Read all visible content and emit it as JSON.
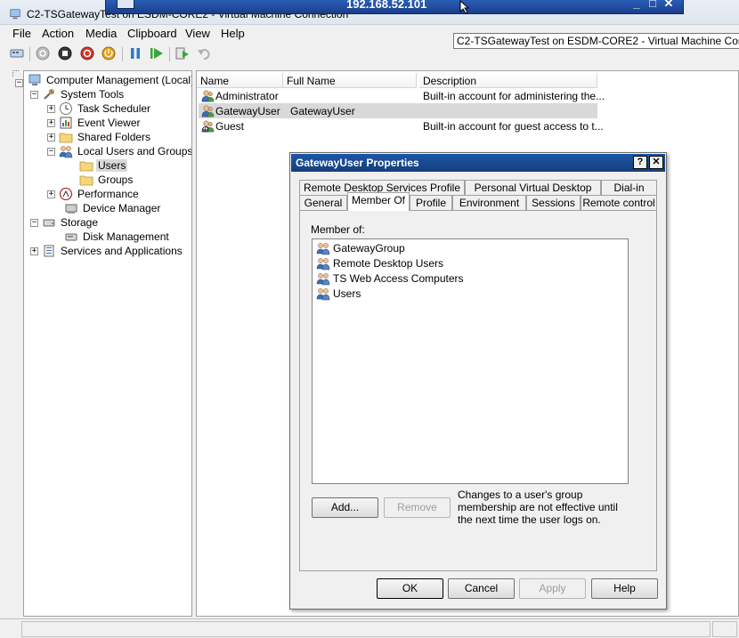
{
  "window": {
    "title": "C2-TSGatewayTest on ESDM-CORE2 - Virtual Machine Connection",
    "remote_address": "192.168.52.101",
    "remote_controls": [
      "_",
      "□",
      "✕"
    ]
  },
  "tooltip": "C2-TSGatewayTest on ESDM-CORE2 - Virtual Machine Conn",
  "menu": [
    "File",
    "Action",
    "Media",
    "Clipboard",
    "View",
    "Help"
  ],
  "toolbar": {
    "icons": [
      "ctrl-alt-del-icon",
      "turn-off-icon",
      "shutdown-icon",
      "power-icon",
      "reset-icon",
      "pause-icon",
      "start-icon",
      "snapshot-icon",
      "revert-icon"
    ]
  },
  "tree": {
    "root": "Computer Management (Local)",
    "system_tools": "System Tools",
    "task_scheduler": "Task Scheduler",
    "event_viewer": "Event Viewer",
    "shared_folders": "Shared Folders",
    "local_users_groups": "Local Users and Groups",
    "users": "Users",
    "groups": "Groups",
    "performance": "Performance",
    "device_manager": "Device Manager",
    "storage": "Storage",
    "disk_management": "Disk Management",
    "services_apps": "Services and Applications"
  },
  "list": {
    "columns": [
      "Name",
      "Full Name",
      "Description"
    ],
    "rows": [
      {
        "name": "Administrator",
        "full_name": "",
        "description": "Built-in account for administering the..."
      },
      {
        "name": "GatewayUser",
        "full_name": "GatewayUser",
        "description": ""
      },
      {
        "name": "Guest",
        "full_name": "",
        "description": "Built-in account for guest access to t..."
      }
    ]
  },
  "dialog": {
    "title": "GatewayUser Properties",
    "help_btn": "?",
    "close_btn": "✕",
    "tabs_row1": [
      "Remote Desktop Services Profile",
      "Personal Virtual Desktop",
      "Dial-in"
    ],
    "tabs_row2": [
      "General",
      "Member Of",
      "Profile",
      "Environment",
      "Sessions",
      "Remote control"
    ],
    "active_tab": "Member Of",
    "member_of_label": "Member of:",
    "members": [
      "GatewayGroup",
      "Remote Desktop Users",
      "TS Web Access Computers",
      "Users"
    ],
    "add_button": "Add...",
    "remove_button": "Remove",
    "note": "Changes to a user's group membership are not effective until the next time the user logs on.",
    "ok": "OK",
    "cancel": "Cancel",
    "apply": "Apply",
    "help": "Help"
  }
}
